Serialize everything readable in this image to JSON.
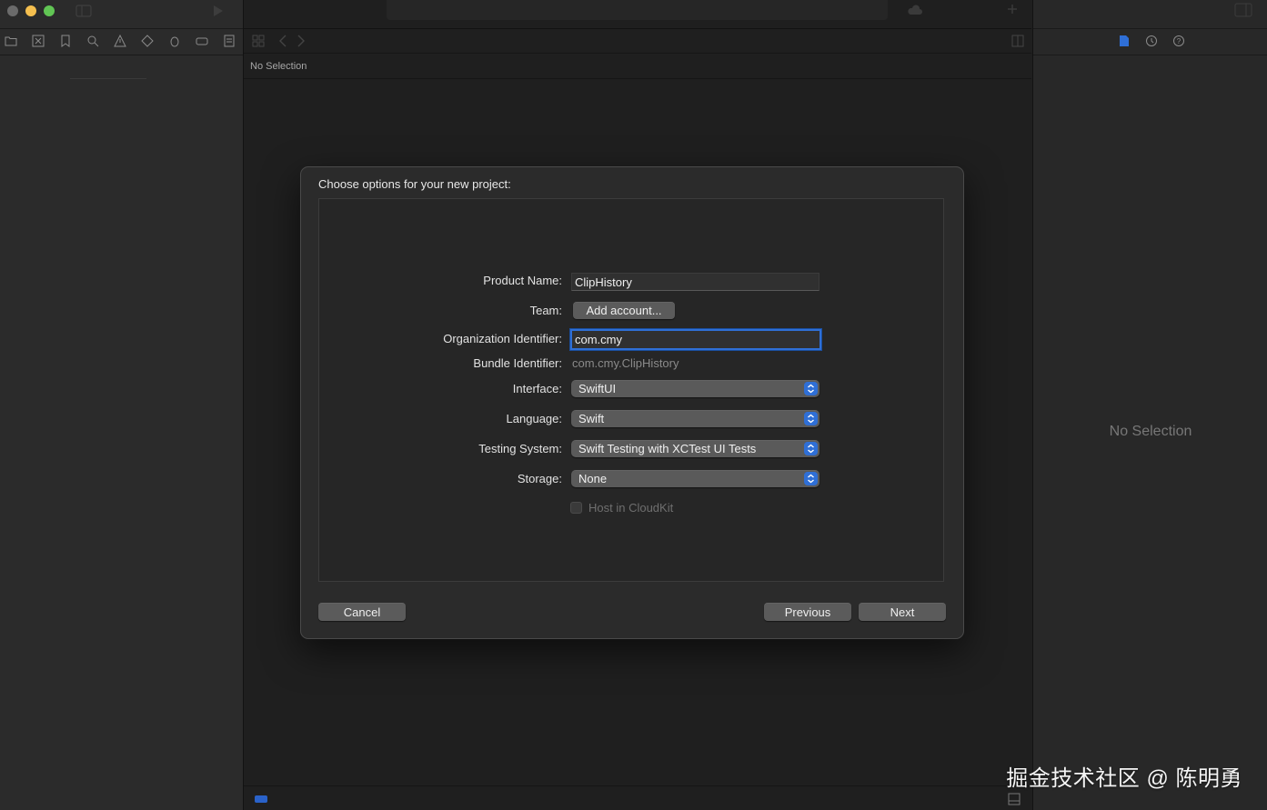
{
  "editor": {
    "no_selection_label": "No Selection"
  },
  "inspector": {
    "no_selection_label": "No Selection"
  },
  "dialog": {
    "title": "Choose options for your new project:",
    "fields": {
      "product_name": {
        "label": "Product Name:",
        "value": "ClipHistory"
      },
      "team": {
        "label": "Team:",
        "button": "Add account..."
      },
      "organization_identifier": {
        "label": "Organization Identifier:",
        "value": "com.cmy"
      },
      "bundle_identifier": {
        "label": "Bundle Identifier:",
        "value": "com.cmy.ClipHistory"
      },
      "interface": {
        "label": "Interface:",
        "value": "SwiftUI"
      },
      "language": {
        "label": "Language:",
        "value": "Swift"
      },
      "testing_system": {
        "label": "Testing System:",
        "value": "Swift Testing with XCTest UI Tests"
      },
      "storage": {
        "label": "Storage:",
        "value": "None"
      },
      "host_in_cloudkit": {
        "label": "Host in CloudKit",
        "checked": false,
        "disabled": true
      }
    },
    "buttons": {
      "cancel": "Cancel",
      "previous": "Previous",
      "next": "Next"
    }
  },
  "watermark": "掘金技术社区 @ 陈明勇",
  "colors": {
    "accent": "#2f6fd6",
    "window_bg": "#1f1f1f",
    "panel_bg": "#2b2b2b"
  }
}
